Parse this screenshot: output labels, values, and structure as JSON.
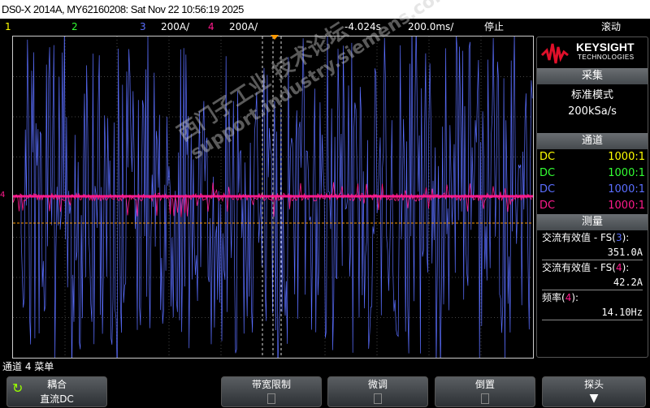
{
  "title": "DS0-X 2014A, MY62160208: Sat Nov 22 10:56:19 2025",
  "status": {
    "ch1": "1",
    "ch2": "2",
    "ch3": "3",
    "ch3_scale": "200A/",
    "ch4": "4",
    "ch4_scale": "200A/",
    "time_offset": "-4.024s",
    "time_scale": "200.0ms/",
    "run_state": "停止",
    "mode": "滚动"
  },
  "colors": {
    "ch1": "#ffff00",
    "ch2": "#33ff33",
    "ch3": "#5a6eff",
    "ch4": "#ff1a8c",
    "trigger": "#ff9900"
  },
  "brand": {
    "name": "KEYSIGHT",
    "sub": "TECHNOLOGIES"
  },
  "acquisition": {
    "header": "采集",
    "mode": "标准模式",
    "rate": "200kSa/s"
  },
  "channels": {
    "header": "通道",
    "items": [
      {
        "coupling": "DC",
        "probe": "1000:1"
      },
      {
        "coupling": "DC",
        "probe": "1000:1"
      },
      {
        "coupling": "DC",
        "probe": "1000:1"
      },
      {
        "coupling": "DC",
        "probe": "1000:1"
      }
    ]
  },
  "measure": {
    "header": "测量",
    "items": [
      {
        "label": "交流有效值 - FS(",
        "ch": "3",
        "end": "):",
        "value": "351.0A"
      },
      {
        "label": "交流有效值 - FS(",
        "ch": "4",
        "end": "):",
        "value": "42.2A"
      },
      {
        "label": "频率(",
        "ch": "4",
        "end": "):",
        "value": "14.10Hz"
      }
    ]
  },
  "menu": {
    "title": "通道 4 菜单",
    "softkeys": [
      {
        "label": "耦合",
        "value": "直流DC"
      },
      {
        "label": "带宽限制"
      },
      {
        "label": "微调"
      },
      {
        "label": "倒置"
      },
      {
        "label": "探头"
      }
    ]
  },
  "ch4_marker": "4",
  "watermark": {
    "line1": "西门子工业  技术论坛",
    "line2": "support.industry.siemens.com/cs"
  }
}
